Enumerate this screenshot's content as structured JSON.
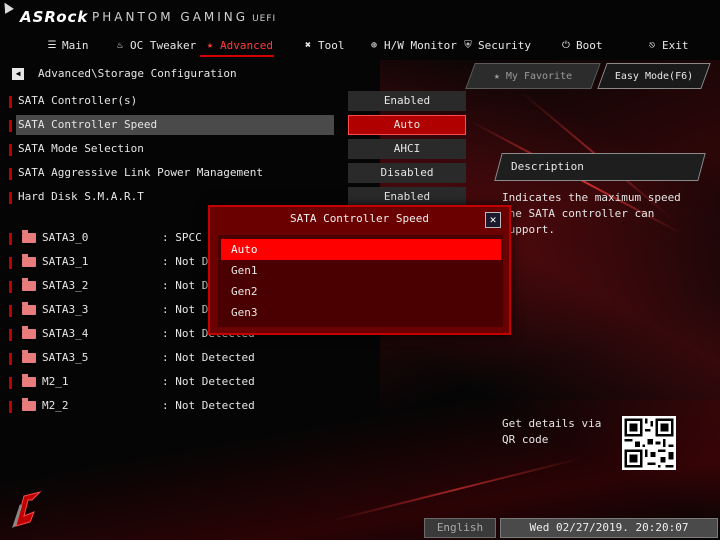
{
  "header": {
    "brand": "ASRock",
    "product": "PHANTOM GAMING",
    "uefi": "UEFI"
  },
  "nav": [
    {
      "label": "Main",
      "icon": "menu-icon"
    },
    {
      "label": "OC Tweaker",
      "icon": "flame-icon"
    },
    {
      "label": "Advanced",
      "icon": "star-icon",
      "active": true
    },
    {
      "label": "Tool",
      "icon": "wrench-icon"
    },
    {
      "label": "H/W Monitor",
      "icon": "globe-icon"
    },
    {
      "label": "Security",
      "icon": "shield-icon"
    },
    {
      "label": "Boot",
      "icon": "power-icon"
    },
    {
      "label": "Exit",
      "icon": "exit-icon"
    }
  ],
  "breadcrumb": "Advanced\\Storage Configuration",
  "top_buttons": {
    "favorite": "My Favorite",
    "easy_mode": "Easy Mode(F6)"
  },
  "settings": [
    {
      "label": "SATA Controller(s)",
      "value": "Enabled"
    },
    {
      "label": "SATA Controller Speed",
      "value": "Auto",
      "selected": true
    },
    {
      "label": "SATA Mode Selection",
      "value": "AHCI"
    },
    {
      "label": "SATA Aggressive Link Power Management",
      "value": "Disabled"
    },
    {
      "label": "Hard Disk S.M.A.R.T",
      "value": "Enabled"
    }
  ],
  "drives": [
    {
      "name": "SATA3_0",
      "status": ": SPCC Solid State Disk"
    },
    {
      "name": "SATA3_1",
      "status": ": Not Detected"
    },
    {
      "name": "SATA3_2",
      "status": ": Not Detected"
    },
    {
      "name": "SATA3_3",
      "status": ": Not Detected"
    },
    {
      "name": "SATA3_4",
      "status": ": Not Detected"
    },
    {
      "name": "SATA3_5",
      "status": ": Not Detected"
    },
    {
      "name": "M2_1",
      "status": ": Not Detected"
    },
    {
      "name": "M2_2",
      "status": ": Not Detected"
    }
  ],
  "description": {
    "title": "Description",
    "text": "Indicates the maximum speed the SATA controller can support."
  },
  "qr": {
    "label": "Get details via QR code"
  },
  "popup": {
    "title": "SATA Controller Speed",
    "close": "✕",
    "options": [
      "Auto",
      "Gen1",
      "Gen2",
      "Gen3"
    ],
    "selected": "Auto"
  },
  "footer": {
    "language": "English",
    "datetime": "Wed 02/27/2019. 20:20:07"
  },
  "colors": {
    "accent": "#d40000",
    "selected_value": "#b00000",
    "popup_bg": "#6b0000",
    "popup_selected": "#ff0000"
  }
}
